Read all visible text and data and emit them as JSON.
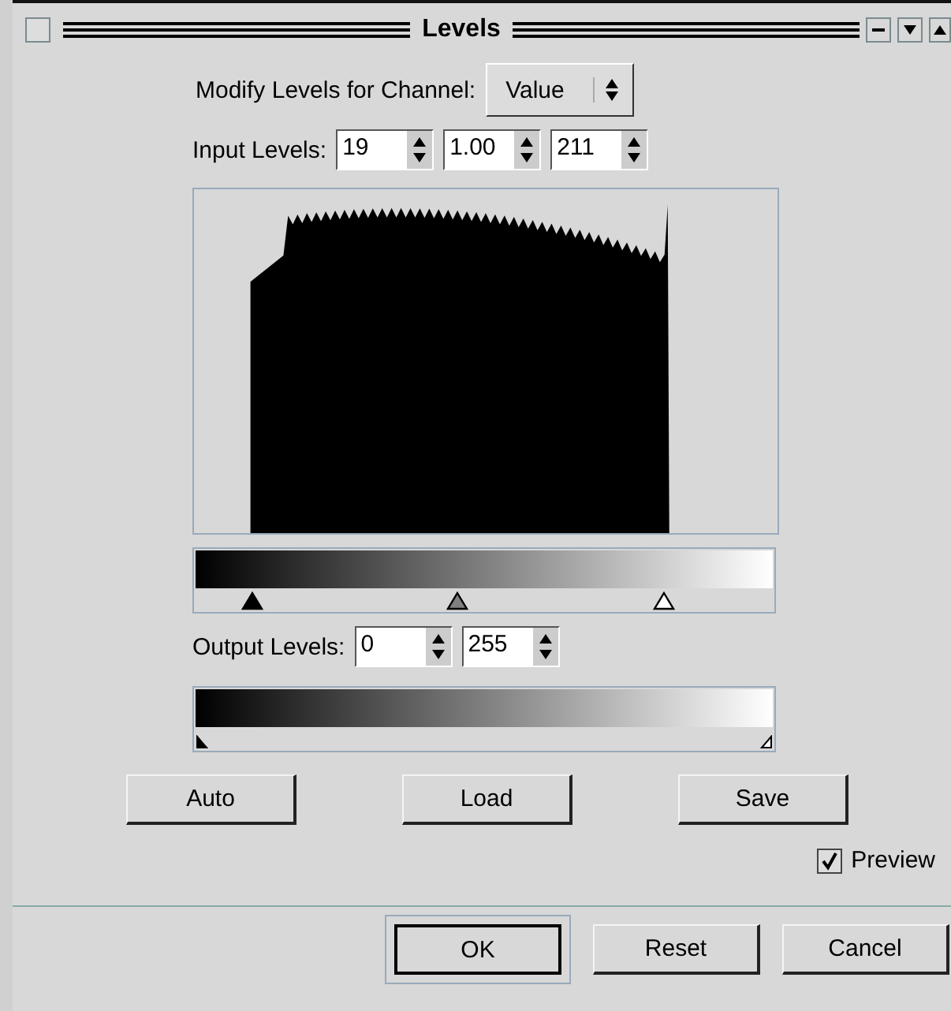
{
  "window": {
    "title": "Levels"
  },
  "channel": {
    "label": "Modify Levels for Channel:",
    "value": "Value"
  },
  "input_levels": {
    "label": "Input Levels:",
    "fields": [
      "19",
      "1.00",
      "211"
    ],
    "handles": [
      {
        "level": 0.075,
        "color": "#000000"
      },
      {
        "level": 0.45,
        "color": "#808080"
      },
      {
        "level": 0.83,
        "color": "#ffffff"
      }
    ]
  },
  "output_levels": {
    "label": "Output Levels:",
    "fields": [
      "0",
      "255"
    ],
    "handles": [
      {
        "level": 0,
        "color": "#000000"
      },
      {
        "level": 1,
        "color": "#ffffff"
      }
    ]
  },
  "actions": [
    "Auto",
    "Load",
    "Save"
  ],
  "preview": {
    "label": "Preview",
    "checked": true
  },
  "buttons": [
    {
      "label": "OK",
      "default": true
    },
    {
      "label": "Reset",
      "default": false
    },
    {
      "label": "Cancel",
      "default": false
    }
  ]
}
